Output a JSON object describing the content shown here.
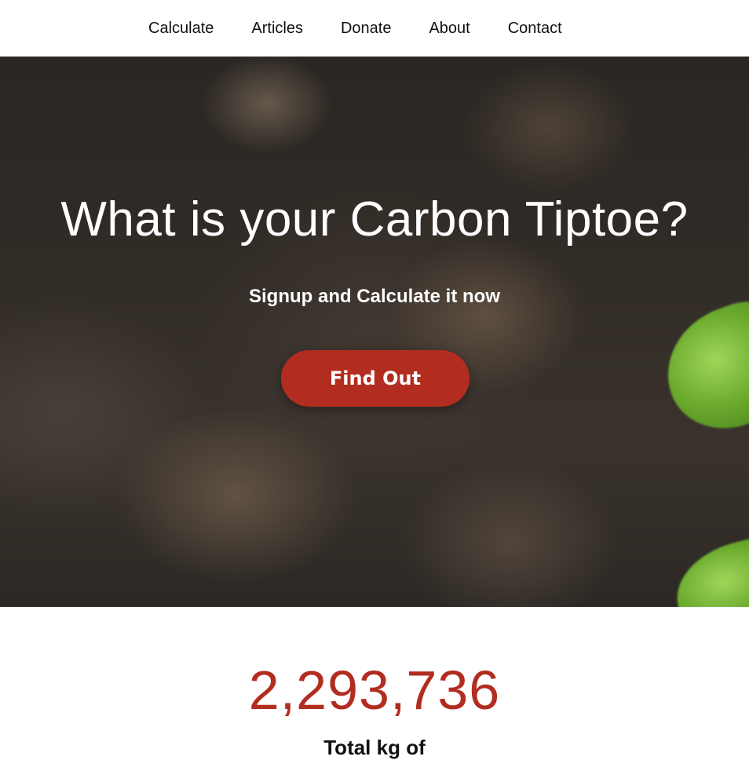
{
  "nav": {
    "items": [
      {
        "label": "Calculate"
      },
      {
        "label": "Articles"
      },
      {
        "label": "Donate"
      },
      {
        "label": "About"
      },
      {
        "label": "Contact"
      }
    ]
  },
  "hero": {
    "title": "What is your Carbon Tiptoe?",
    "subtitle": "Signup and Calculate it now",
    "cta_label": "Find Out"
  },
  "stats": {
    "number": "2,293,736",
    "label": "Total kg of"
  },
  "colors": {
    "accent": "#b22d20",
    "nav_text": "#111111",
    "hero_text": "#ffffff"
  }
}
